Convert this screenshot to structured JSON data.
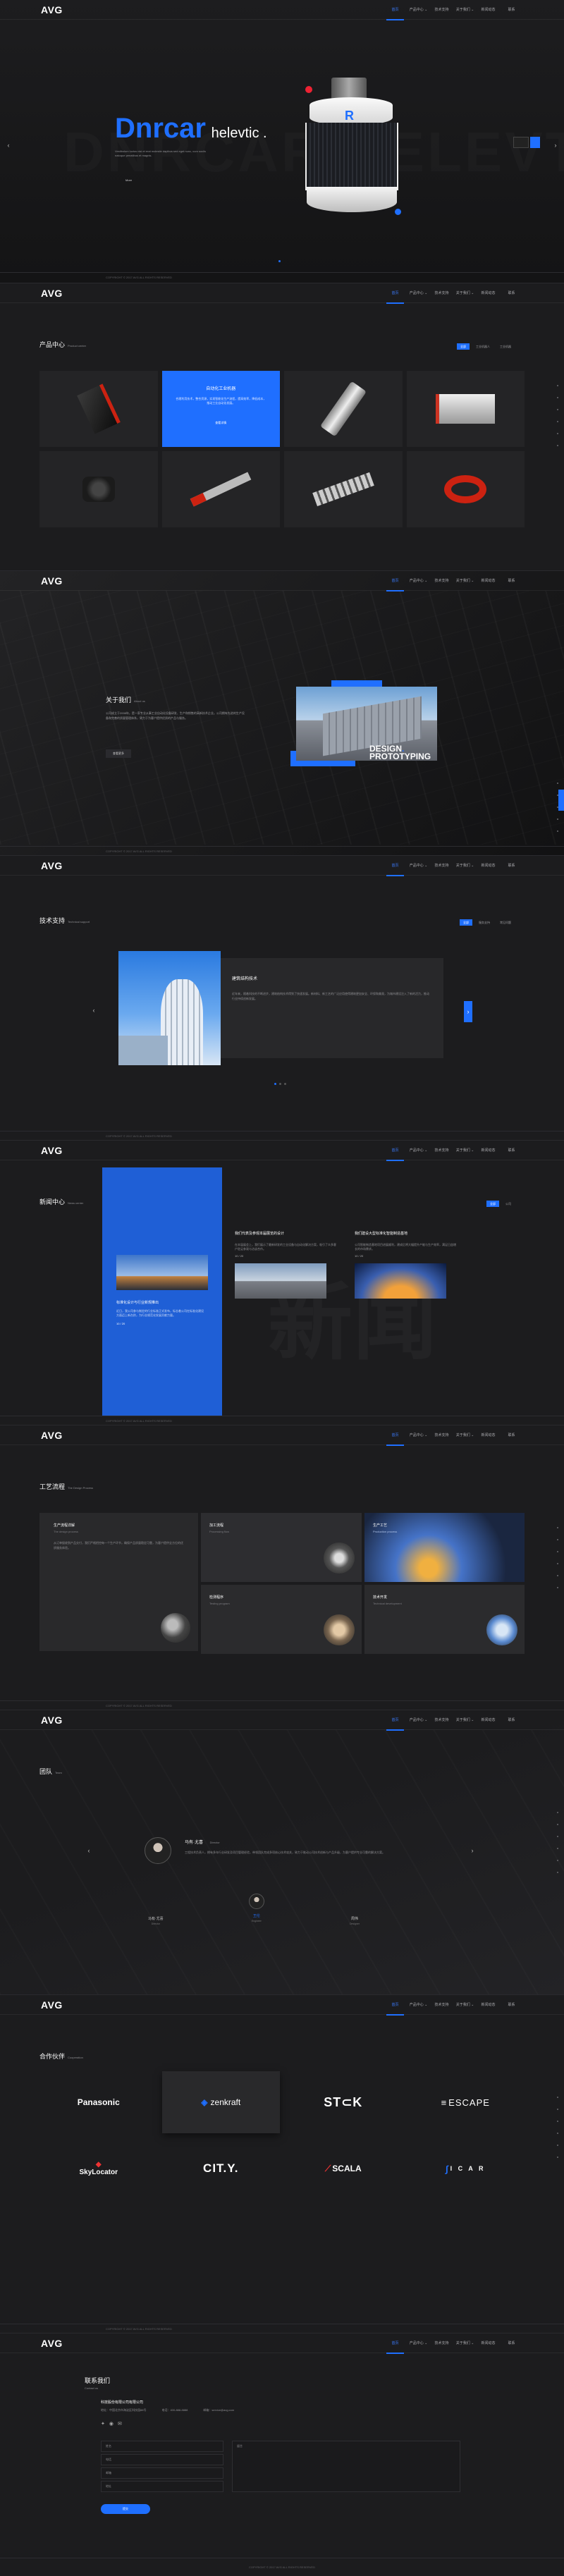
{
  "nav": {
    "logo": "AVG",
    "items": [
      "首页",
      "产品中心 ⌄",
      "技术支持",
      "关于我们 ⌄",
      "新闻动态",
      "联系"
    ]
  },
  "colors": {
    "accent": "#1f6fff",
    "bg": "#1c1c1e",
    "panel": "#242426"
  },
  "hero": {
    "brand": "Dnrcar",
    "brand_suffix": "helevtic .",
    "copy": "Vestibulum luctus nisi et erat molestie dapibus sed eget nunc, cum sociis natoque penatibus et magnis.",
    "more_label": "More",
    "watermark": "DNRCAR HELEVTIC",
    "prev_icon": "chevron-left-icon",
    "next_icon": "chevron-right-icon"
  },
  "footer_text": "COPYRIGHT © 2017 AVG ALL RIGHTS RESERVED",
  "products": {
    "title": "产品中心",
    "title_en": "Product center",
    "tabs": [
      "全部",
      "工业机器人",
      "工业机器"
    ],
    "highlight": {
      "name": "自动化工业机器",
      "desc": "合理利用技术，整合资源，实现智能化生产流程，提高效率，降低成本，推动工业自动化发展。",
      "btn": "查看详情"
    }
  },
  "about": {
    "title": "关于我们",
    "title_en": "About us",
    "body": "公司成立于2008年，是一家专业从事工业自动化设备研发、生产和销售的高新技术企业。公司拥有先进的生产设备和完善的质量管理体系，致力于为客户提供优质的产品与服务。",
    "btn": "查看更多",
    "design_line1": "DESIGN",
    "design_dot": ".",
    "design_line2": "PROTOTYPING"
  },
  "tech": {
    "title": "技术支持",
    "title_en": "Technical support",
    "tabs": [
      "全部",
      "服务支持",
      "常见问题"
    ],
    "card_title": "建筑结构技术",
    "card_body": "近年来，随着科技的不断进步，建筑结构技术得到了快速发展。新材料、新工艺的广泛应用使得建筑更加安全、环保和美观，为城市建设注入了新的活力，推动行业持续创新发展。"
  },
  "news": {
    "title": "新闻中心",
    "title_en": "News center",
    "tabs": [
      "全部",
      "公司"
    ],
    "feature": {
      "title": "标准化设计与行业新规推出",
      "desc": "近日，我公司参与制定的行业标准正式发布，标志着公司在标准化建设方面迈上新台阶，为行业规范化发展贡献力量。",
      "date": "10 / 20"
    },
    "items": [
      {
        "title": "我们代表及参观本届展览的设计",
        "desc": "在本届展会上，我们展示了最新研发的工业设备与自动化解决方案，吸引了众多客户驻足参观与洽谈合作。",
        "date": "10 / 20"
      },
      {
        "title": "我们建设大型标准化智能制造基地",
        "desc": "公司智能制造基地项目进展顺利，建成后将大幅提升产能与生产效率，满足日益增长的市场需求。",
        "date": "10 / 20"
      }
    ]
  },
  "process": {
    "title": "工艺流程",
    "title_en": "The Design Process",
    "items": [
      {
        "name": "生产流程详解",
        "en": "The design process",
        "desc": "从订单接收到产品交付，我们严格把控每一个生产环节，确保产品质量稳定可靠，为客户提供全方位的优质服务体验。"
      },
      {
        "name": "加工流程",
        "en": "Processing flow"
      },
      {
        "name": "生产工艺",
        "en": "Production process"
      },
      {
        "name": "检测程序",
        "en": "Testing program"
      },
      {
        "name": "技术开发",
        "en": "Technical development"
      }
    ]
  },
  "team": {
    "title": "团队",
    "title_en": "Team",
    "member_name": "马有·尤喜",
    "member_role": "Director",
    "quote": "工程技术负责人，拥有多年行业研发及项目管理经验，带领团队完成多项核心技术攻关，致力于推动公司技术创新与产品升级，为客户提供专业可靠的解决方案。",
    "members": [
      {
        "name": "马有·尤喜",
        "role": "Director"
      },
      {
        "name": "王伦",
        "role": "Engineer"
      },
      {
        "name": "周伟",
        "role": "Designer"
      }
    ]
  },
  "partners": {
    "title": "合作伙伴",
    "title_en": "Cooperation",
    "logos": [
      "Panasonic",
      "zenkraft",
      "ST⊂K",
      "ESCAPE",
      "SkyLocator",
      "CIT.Y.",
      "SCALA",
      "I C A R"
    ]
  },
  "contact": {
    "title": "联系我们",
    "title_en": "Contact us",
    "company": "科技股份有限公司有限公司",
    "info": [
      "地址：中国北京市海淀区科技园88号",
      "电话：400-888-8888",
      "邮箱：service@avg.com"
    ],
    "fields": [
      "姓名",
      "电话",
      "邮箱",
      "地址"
    ],
    "message_placeholder": "留言",
    "submit": "提交"
  }
}
